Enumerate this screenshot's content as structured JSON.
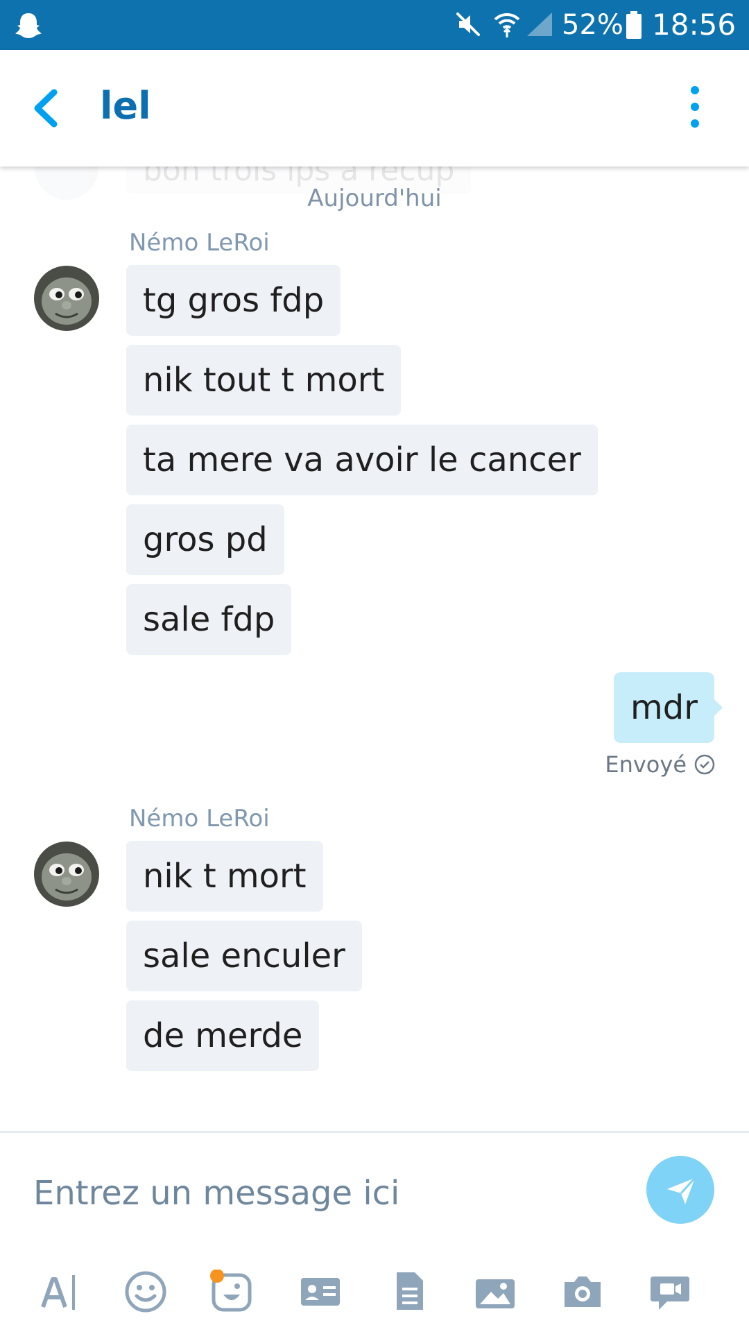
{
  "status_bar": {
    "battery_percent": "52%",
    "time": "18:56",
    "icons": [
      "snapchat-ghost-icon",
      "mute-icon",
      "wifi-icon",
      "signal-icon",
      "battery-icon"
    ]
  },
  "header": {
    "title": "lel",
    "icons": [
      "back-arrow-icon",
      "more-options-icon"
    ]
  },
  "conversation": {
    "previous_message_faded": "bon trois ips a recup",
    "date_separator": "Aujourd'hui",
    "groups": [
      {
        "sender": "Némo LeRoi",
        "messages": [
          "tg gros fdp",
          "nik tout t mort",
          "ta mere va avoir le cancer",
          "gros pd",
          "sale fdp"
        ]
      },
      {
        "outgoing": true,
        "messages": [
          "mdr"
        ],
        "status": "Envoyé"
      },
      {
        "sender": "Némo LeRoi",
        "messages": [
          "nik t mort",
          "sale enculer",
          "de merde"
        ]
      }
    ]
  },
  "composer": {
    "placeholder": "Entrez un message ici",
    "toolbar_icons": [
      "text-format-icon",
      "emoji-icon",
      "sticker-icon",
      "contact-card-icon",
      "file-icon",
      "photo-gallery-icon",
      "camera-icon",
      "video-message-icon"
    ]
  },
  "colors": {
    "status_bar": "#0d72ad",
    "accent": "#0b6fb0",
    "incoming_bubble": "#eef1f5",
    "outgoing_bubble": "#c7ecfa",
    "send_button": "#7fd3f7",
    "notification_dot": "#f7931e"
  }
}
